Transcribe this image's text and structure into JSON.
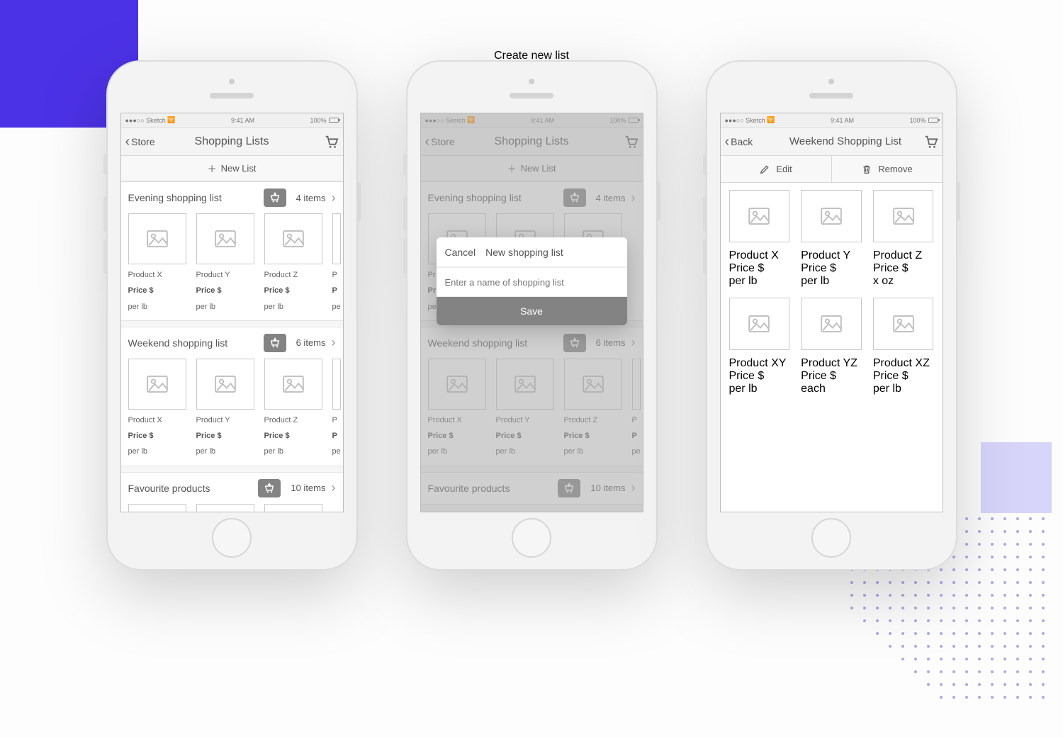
{
  "peek_title_above": "Create new list",
  "status": {
    "carrier": "●●●○○ Sketch",
    "wifi": "⌵",
    "time": "9:41 AM",
    "batt": "100%"
  },
  "screen1": {
    "back_label": "Store",
    "title": "Shopping Lists",
    "new_list": "New List",
    "sections": [
      {
        "name": "Evening shopping list",
        "count": "4 items",
        "products": [
          {
            "name": "Product X",
            "price": "Price $",
            "unit": "per lb"
          },
          {
            "name": "Product Y",
            "price": "Price $",
            "unit": "per lb"
          },
          {
            "name": "Product Z",
            "price": "Price $",
            "unit": "per lb"
          }
        ],
        "peek": {
          "name": "P",
          "price": "P",
          "unit": "pe"
        }
      },
      {
        "name": "Weekend shopping list",
        "count": "6 items",
        "products": [
          {
            "name": "Product X",
            "price": "Price $",
            "unit": "per lb"
          },
          {
            "name": "Product Y",
            "price": "Price $",
            "unit": "per lb"
          },
          {
            "name": "Product Z",
            "price": "Price $",
            "unit": "per lb"
          }
        ],
        "peek": {
          "name": "P",
          "price": "P",
          "unit": "pe"
        }
      },
      {
        "name": "Favourite products",
        "count": "10 items"
      }
    ]
  },
  "screen2": {
    "back_label": "Store",
    "title": "Shopping Lists",
    "new_list": "New List",
    "modal": {
      "cancel": "Cancel",
      "title": "New shopping list",
      "placeholder": "Enter a name of shopping list",
      "save": "Save"
    },
    "sections": [
      {
        "name": "Evening shopping list",
        "count": "4 items"
      },
      {
        "name": "Weekend shopping list",
        "count": "6 items",
        "products": [
          {
            "name": "Product X",
            "price": "Price $",
            "unit": "per lb"
          },
          {
            "name": "Product Y",
            "price": "Price $",
            "unit": "per lb"
          },
          {
            "name": "Product Z",
            "price": "Price $",
            "unit": "per lb"
          }
        ],
        "peek": {
          "name": "P",
          "price": "P",
          "unit": "pe"
        }
      },
      {
        "name": "Favourite products",
        "count": "10 items"
      }
    ]
  },
  "screen3": {
    "back_label": "Back",
    "title": "Weekend Shopping List",
    "edit": "Edit",
    "remove": "Remove",
    "products": [
      {
        "name": "Product X",
        "price": "Price $",
        "unit": "per lb"
      },
      {
        "name": "Product Y",
        "price": "Price $",
        "unit": "per lb"
      },
      {
        "name": "Product Z",
        "price": "Price $",
        "unit": "x oz"
      },
      {
        "name": "Product XY",
        "price": "Price $",
        "unit": "per lb"
      },
      {
        "name": "Product YZ",
        "price": "Price $",
        "unit": "each"
      },
      {
        "name": "Product XZ",
        "price": "Price $",
        "unit": "per lb"
      }
    ]
  }
}
